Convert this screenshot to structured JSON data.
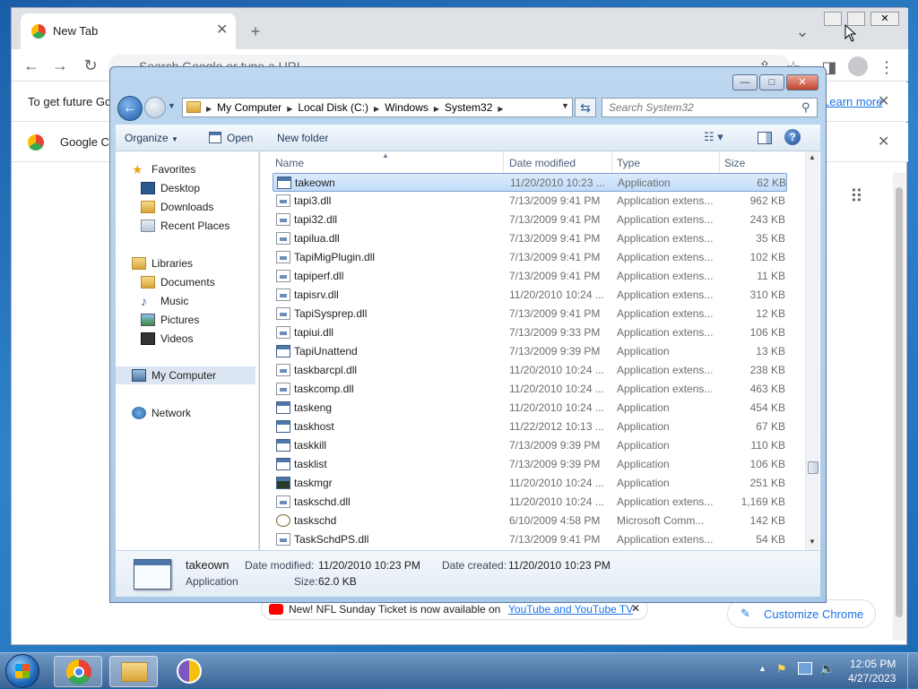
{
  "chrome": {
    "tab_title": "New Tab",
    "omnibox_placeholder": "Search Google or type a URL",
    "banner_text": "To get future Go",
    "banner_link": "Learn more",
    "banner2_text": "Google Ch",
    "notice_text": "New! NFL Sunday Ticket is now available on",
    "notice_link": "YouTube and YouTube TV",
    "customize_label": "Customize Chrome",
    "window_controls": [
      "minimize",
      "restore",
      "close"
    ]
  },
  "explorer": {
    "breadcrumb": [
      "My Computer",
      "Local Disk (C:)",
      "Windows",
      "System32"
    ],
    "search_placeholder": "Search System32",
    "toolbar": {
      "organize": "Organize",
      "open": "Open",
      "new_folder": "New folder"
    },
    "nav": {
      "favorites_header": "Favorites",
      "favorites": [
        "Desktop",
        "Downloads",
        "Recent Places"
      ],
      "libraries_header": "Libraries",
      "libraries": [
        "Documents",
        "Music",
        "Pictures",
        "Videos"
      ],
      "computer": "My Computer",
      "network": "Network"
    },
    "columns": {
      "name": "Name",
      "date": "Date modified",
      "type": "Type",
      "size": "Size"
    },
    "files": [
      {
        "name": "takeown",
        "date": "11/20/2010 10:23 ...",
        "type": "Application",
        "size": "62 KB",
        "icon": "app"
      },
      {
        "name": "tapi3.dll",
        "date": "7/13/2009 9:41 PM",
        "type": "Application extens...",
        "size": "962 KB",
        "icon": "dll"
      },
      {
        "name": "tapi32.dll",
        "date": "7/13/2009 9:41 PM",
        "type": "Application extens...",
        "size": "243 KB",
        "icon": "dll"
      },
      {
        "name": "tapilua.dll",
        "date": "7/13/2009 9:41 PM",
        "type": "Application extens...",
        "size": "35 KB",
        "icon": "dll"
      },
      {
        "name": "TapiMigPlugin.dll",
        "date": "7/13/2009 9:41 PM",
        "type": "Application extens...",
        "size": "102 KB",
        "icon": "dll"
      },
      {
        "name": "tapiperf.dll",
        "date": "7/13/2009 9:41 PM",
        "type": "Application extens...",
        "size": "11 KB",
        "icon": "dll"
      },
      {
        "name": "tapisrv.dll",
        "date": "11/20/2010 10:24 ...",
        "type": "Application extens...",
        "size": "310 KB",
        "icon": "dll"
      },
      {
        "name": "TapiSysprep.dll",
        "date": "7/13/2009 9:41 PM",
        "type": "Application extens...",
        "size": "12 KB",
        "icon": "dll"
      },
      {
        "name": "tapiui.dll",
        "date": "7/13/2009 9:33 PM",
        "type": "Application extens...",
        "size": "106 KB",
        "icon": "dll"
      },
      {
        "name": "TapiUnattend",
        "date": "7/13/2009 9:39 PM",
        "type": "Application",
        "size": "13 KB",
        "icon": "app"
      },
      {
        "name": "taskbarcpl.dll",
        "date": "11/20/2010 10:24 ...",
        "type": "Application extens...",
        "size": "238 KB",
        "icon": "dll"
      },
      {
        "name": "taskcomp.dll",
        "date": "11/20/2010 10:24 ...",
        "type": "Application extens...",
        "size": "463 KB",
        "icon": "dll"
      },
      {
        "name": "taskeng",
        "date": "11/20/2010 10:24 ...",
        "type": "Application",
        "size": "454 KB",
        "icon": "app"
      },
      {
        "name": "taskhost",
        "date": "11/22/2012 10:13 ...",
        "type": "Application",
        "size": "67 KB",
        "icon": "app"
      },
      {
        "name": "taskkill",
        "date": "7/13/2009 9:39 PM",
        "type": "Application",
        "size": "110 KB",
        "icon": "app"
      },
      {
        "name": "tasklist",
        "date": "7/13/2009 9:39 PM",
        "type": "Application",
        "size": "106 KB",
        "icon": "app"
      },
      {
        "name": "taskmgr",
        "date": "11/20/2010 10:24 ...",
        "type": "Application",
        "size": "251 KB",
        "icon": "mgr"
      },
      {
        "name": "taskschd.dll",
        "date": "11/20/2010 10:24 ...",
        "type": "Application extens...",
        "size": "1,169 KB",
        "icon": "dll"
      },
      {
        "name": "taskschd",
        "date": "6/10/2009 4:58 PM",
        "type": "Microsoft Comm...",
        "size": "142 KB",
        "icon": "msc"
      },
      {
        "name": "TaskSchdPS.dll",
        "date": "7/13/2009 9:41 PM",
        "type": "Application extens...",
        "size": "54 KB",
        "icon": "dll"
      }
    ],
    "selected_index": 0,
    "details": {
      "name": "takeown",
      "type": "Application",
      "date_modified_label": "Date modified:",
      "date_modified": "11/20/2010 10:23 PM",
      "date_created_label": "Date created:",
      "date_created": "11/20/2010 10:23 PM",
      "size_label": "Size:",
      "size": "62.0 KB"
    }
  },
  "taskbar": {
    "time": "12:05 PM",
    "date": "4/27/2023"
  }
}
